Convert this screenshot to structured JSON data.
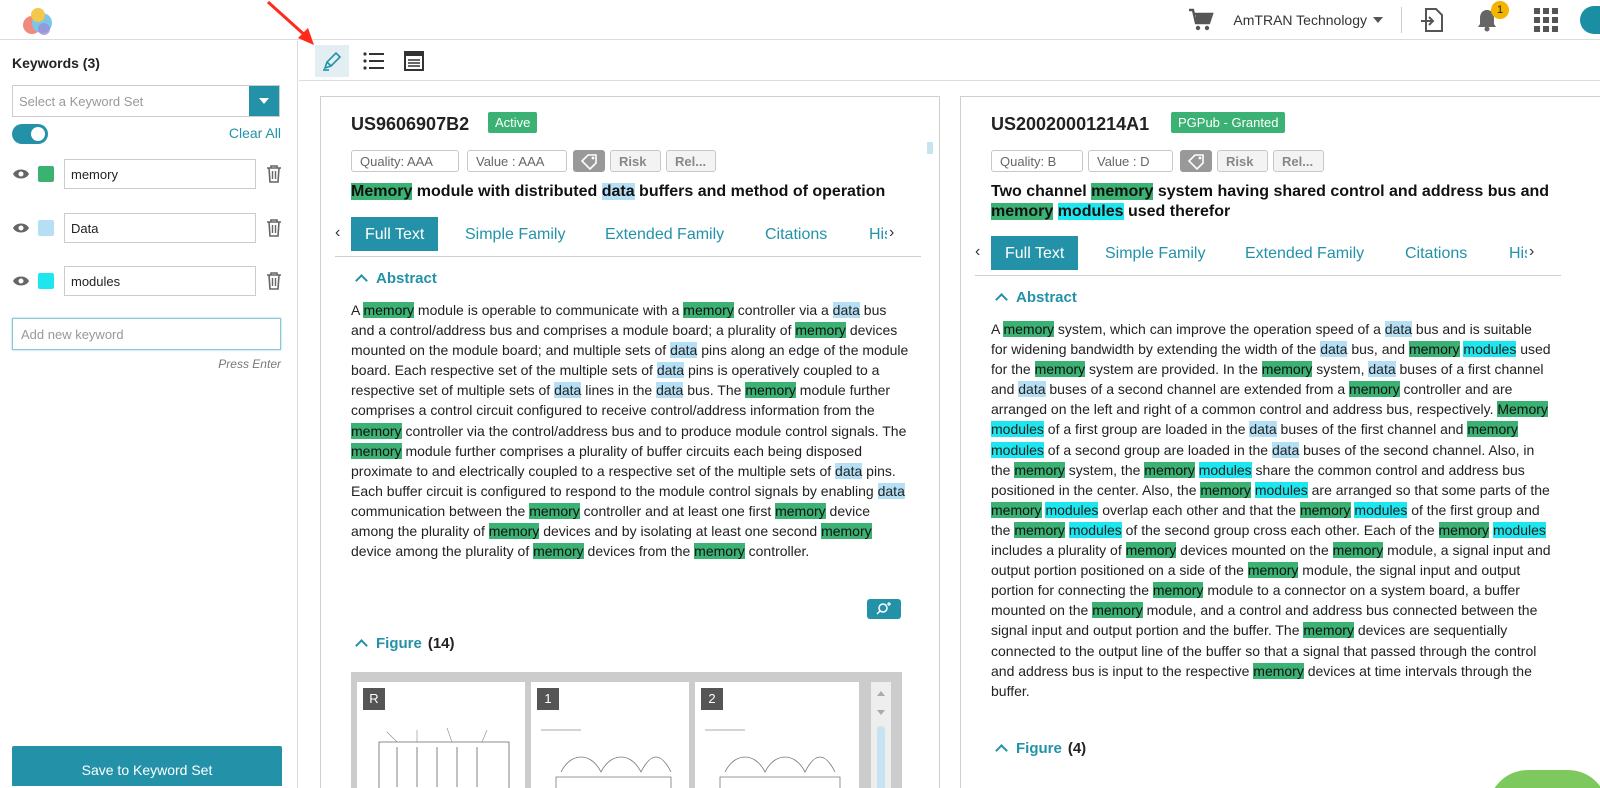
{
  "header": {
    "company": "AmTRAN Technology",
    "notification_count": "1"
  },
  "sidebar": {
    "title": "Keywords (3)",
    "select_placeholder": "Select a Keyword Set",
    "clear_all": "Clear All",
    "keywords": [
      {
        "label": "memory",
        "color": "#3bb273"
      },
      {
        "label": "Data",
        "color": "#b5dff5"
      },
      {
        "label": "modules",
        "color": "#1ee6ee"
      }
    ],
    "add_placeholder": "Add new keyword",
    "press_enter": "Press Enter",
    "save_button": "Save to Keyword Set"
  },
  "colors": {
    "accent": "#2392a8",
    "active_status": "#3bb273"
  },
  "panels": [
    {
      "number": "US9606907B2",
      "status": "Active",
      "quality": "Quality:  AAA",
      "value": "Value :  AAA",
      "risk": "Risk",
      "rel": "Rel...",
      "tabs": [
        "Full Text",
        "Simple Family",
        "Extended Family",
        "Citations",
        "His"
      ],
      "abstract_heading": "Abstract",
      "figure_heading": "Figure",
      "figure_count": "(14)",
      "figure_labels": [
        "R",
        "1",
        "2"
      ]
    },
    {
      "number": "US20020001214A1",
      "status": "PGPub - Granted",
      "quality": "Quality:  B",
      "value": "Value :  D",
      "risk": "Risk",
      "rel": "Rel...",
      "tabs": [
        "Full Text",
        "Simple Family",
        "Extended Family",
        "Citations",
        "His"
      ],
      "abstract_heading": "Abstract",
      "figure_heading": "Figure",
      "figure_count": "(4)"
    }
  ]
}
